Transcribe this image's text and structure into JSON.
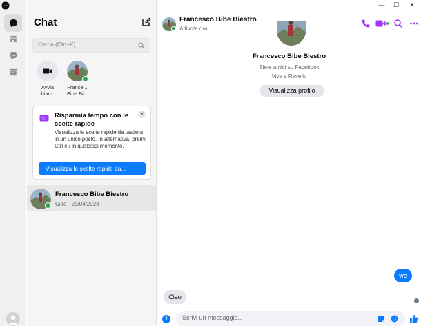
{
  "app": {
    "title": "Chat"
  },
  "rail": {
    "items": [
      "chat-icon",
      "marketplace-icon",
      "requests-icon",
      "archive-icon"
    ]
  },
  "chat_list": {
    "title": "Chat",
    "search_placeholder": "Cerca (Ctrl+K)",
    "stories": [
      {
        "label_line1": "Avvia",
        "label_line2": "chiam..."
      },
      {
        "label_line1": "France...",
        "label_line2": "Bibe Bi..."
      }
    ],
    "tip_card": {
      "title": "Risparmia tempo con le scelte rapide",
      "body": "Visualizza le scelte rapide da tastiera in un unico posto. In alternativa, premi Ctrl e / in qualsiasi momento.",
      "button": "Visualizza le scelte rapide da...",
      "close": "✕"
    },
    "conversations": [
      {
        "name": "Francesco Bibe Biestro",
        "preview": "Ciao · 25/04/2023"
      }
    ]
  },
  "window_controls": {
    "minimize": "—",
    "maximize": "☐",
    "close": "✕"
  },
  "conversation": {
    "header": {
      "name": "Francesco Bibe Biestro",
      "status": "Attivo/a ora"
    },
    "profile": {
      "name": "Francesco Bibe Biestro",
      "line1": "Siete amici su Facebook",
      "line2": "Vive a Revello",
      "button": "Visualizza profilo"
    },
    "messages": [
      {
        "direction": "out",
        "text": "we"
      },
      {
        "direction": "in",
        "text": "Ciao"
      }
    ],
    "composer": {
      "placeholder": "Scrivi un messaggio...",
      "plus": "+"
    }
  },
  "colors": {
    "accent": "#0a7cff",
    "header_icons": "#a033ff",
    "online": "#31a24c"
  }
}
